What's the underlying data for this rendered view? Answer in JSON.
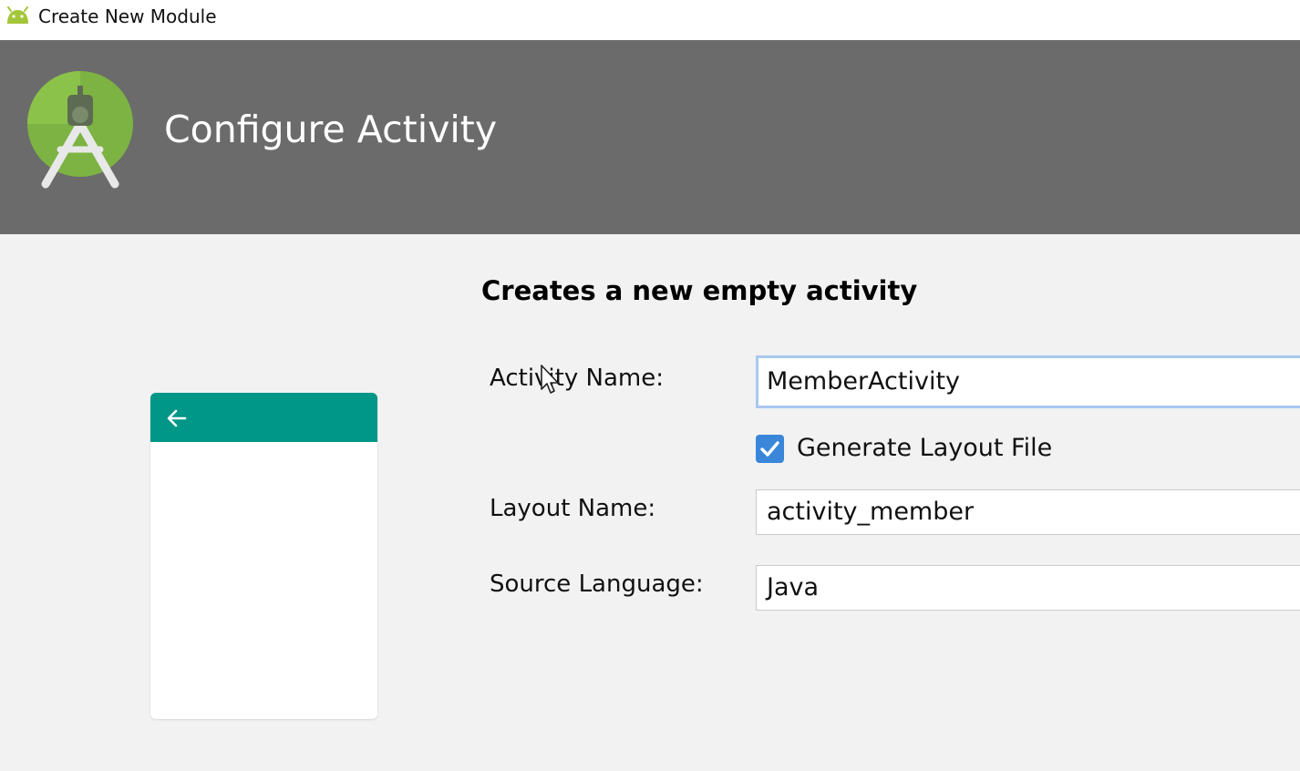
{
  "window": {
    "title": "Create New Module"
  },
  "banner": {
    "heading": "Configure Activity"
  },
  "form": {
    "description": "Creates a new empty activity",
    "activity_name": {
      "label": "Activity Name:",
      "value": "MemberActivity"
    },
    "generate_layout": {
      "label": "Generate Layout File",
      "checked": true
    },
    "layout_name": {
      "label": "Layout Name:",
      "value": "activity_member"
    },
    "source_language": {
      "label": "Source Language:",
      "value": "Java"
    }
  },
  "colors": {
    "banner_bg": "#6b6b6b",
    "preview_appbar": "#009688",
    "checkbox_accent": "#3a86d9",
    "focus_border": "#a8c8ef",
    "android_green": "#a4c639"
  },
  "icons": {
    "window": "android-icon",
    "logo": "android-studio-logo",
    "preview_back": "arrow-left-icon",
    "checkbox": "check-icon"
  }
}
